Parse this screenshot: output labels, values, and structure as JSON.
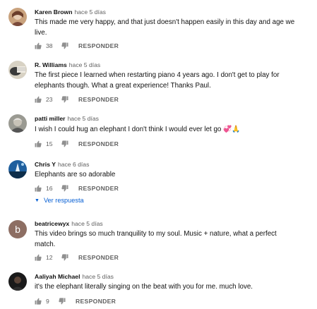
{
  "comments": [
    {
      "author": "Karen Brown",
      "time": "hace 5 días",
      "lines": [
        "This made me very happy, and that just doesn't happen easily in this day and age we",
        "live."
      ],
      "likes": "38",
      "reply_label": "RESPONDER",
      "avatar_icon": "photo-avatar"
    },
    {
      "author": "R. Williams",
      "time": "hace 5 días",
      "lines": [
        "The first piece I learned when restarting piano 4 years ago.  I don't get to play for",
        "elephants though.  What a great experience!   Thanks Paul."
      ],
      "likes": "23",
      "reply_label": "RESPONDER",
      "avatar_icon": "photo-avatar"
    },
    {
      "author": "patti miller",
      "time": "hace 5 días",
      "lines": [
        "I wish I could hug an elephant I don't think I would ever let go 💞🙏"
      ],
      "likes": "15",
      "reply_label": "RESPONDER",
      "avatar_icon": "photo-avatar"
    },
    {
      "author": "Chris Y",
      "time": "hace 6 días",
      "lines": [
        "Elephants are so adorable"
      ],
      "likes": "16",
      "reply_label": "RESPONDER",
      "avatar_icon": "photo-avatar",
      "view_replies": "Ver respuesta"
    },
    {
      "author": "beatricewyx",
      "time": "hace 5 días",
      "lines": [
        "This video brings so much tranquility to my soul. Music + nature, what a perfect",
        "match."
      ],
      "likes": "12",
      "reply_label": "RESPONDER",
      "avatar_letter": "b",
      "avatar_color": "#8d6e63"
    },
    {
      "author": "Aaliyah Michael",
      "time": "hace 5 días",
      "lines": [
        "it's the elephant literally singing on the beat with you for me. much love."
      ],
      "likes": "9",
      "reply_label": "RESPONDER",
      "avatar_icon": "photo-avatar"
    }
  ],
  "colors": {
    "link": "#065fd4",
    "meta": "#606060",
    "text": "#111111"
  }
}
